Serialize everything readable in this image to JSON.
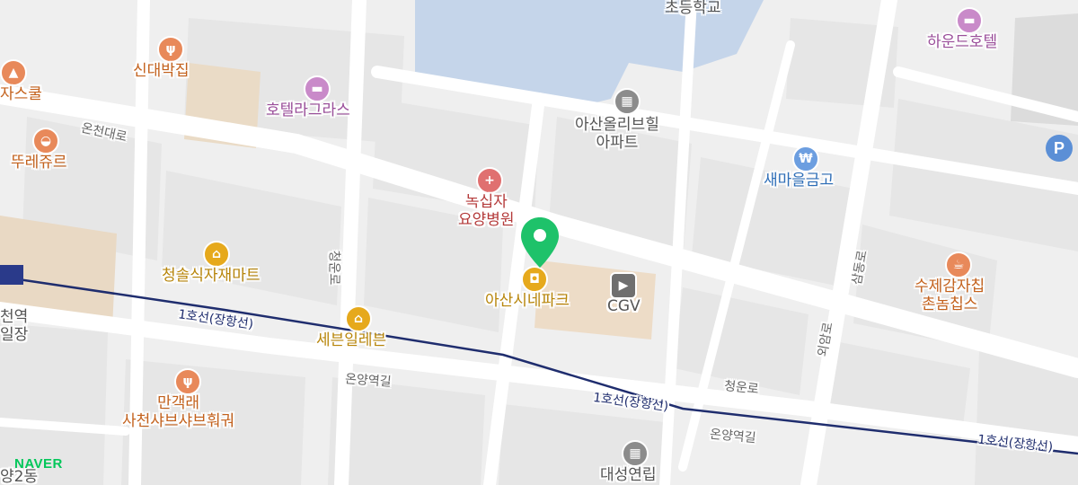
{
  "map": {
    "provider_logo": "NAVER",
    "marker_color": "#1ec26a",
    "rail_color": "#1f2d6e",
    "pois": {
      "school": "초등학교",
      "hotel_haund": "하운드호텔",
      "sindaebak": "신대박집",
      "pizza": "자스쿨",
      "hotel_lagrass": "호텔라그라스",
      "asan_olive_line1": "아산올리브힐",
      "asan_olive_line2": "아파트",
      "tteurejur": "뚜레쥬르",
      "saemaul": "새마을금고",
      "green_cross_line1": "녹십자",
      "green_cross_line2": "요양병원",
      "cheongsol": "청솔식자재마트",
      "asan_cinepark": "아산시네파크",
      "cgv": "CGV",
      "sujegamja_line1": "수제감자칩",
      "sujegamja_line2": "촌놈칩스",
      "station_line1": "천역",
      "station_line2": "일장",
      "seven_eleven": "세븐일레븐",
      "mangaekrae_line1": "만객래",
      "mangaekrae_line2": "사천샤브샤브훠궈",
      "daesung_line1": "대성연립",
      "dong": "양2동"
    },
    "roads": {
      "oncheon": "온천대로",
      "cheongun_vertical": "청운로",
      "onyangyeok_1": "온양역길",
      "cheongun_2": "청운로",
      "onyangyeok_2": "온양역길",
      "samdong": "삼동로",
      "oeam": "외암로"
    },
    "rail_labels": {
      "r1": "1호선(장항선)",
      "r2": "1호선(장항선)",
      "r3": "1호선(장항선)"
    },
    "icons": {
      "parking": "P"
    }
  }
}
